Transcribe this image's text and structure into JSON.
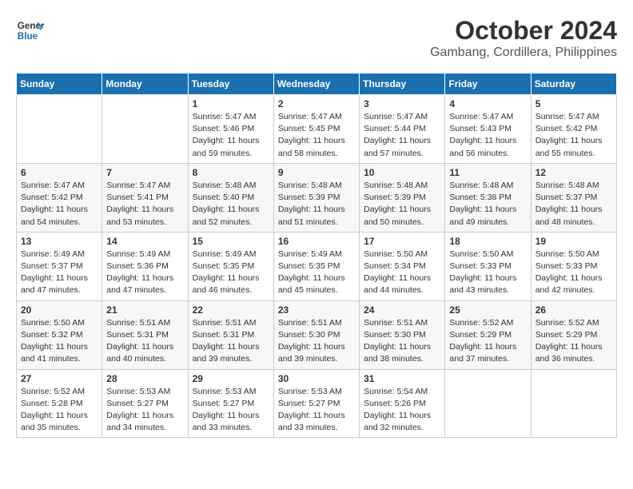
{
  "header": {
    "logo_line1": "General",
    "logo_line2": "Blue",
    "month": "October 2024",
    "location": "Gambang, Cordillera, Philippines"
  },
  "weekdays": [
    "Sunday",
    "Monday",
    "Tuesday",
    "Wednesday",
    "Thursday",
    "Friday",
    "Saturday"
  ],
  "weeks": [
    [
      {
        "day": "",
        "sunrise": "",
        "sunset": "",
        "daylight": ""
      },
      {
        "day": "",
        "sunrise": "",
        "sunset": "",
        "daylight": ""
      },
      {
        "day": "1",
        "sunrise": "Sunrise: 5:47 AM",
        "sunset": "Sunset: 5:46 PM",
        "daylight": "Daylight: 11 hours and 59 minutes."
      },
      {
        "day": "2",
        "sunrise": "Sunrise: 5:47 AM",
        "sunset": "Sunset: 5:45 PM",
        "daylight": "Daylight: 11 hours and 58 minutes."
      },
      {
        "day": "3",
        "sunrise": "Sunrise: 5:47 AM",
        "sunset": "Sunset: 5:44 PM",
        "daylight": "Daylight: 11 hours and 57 minutes."
      },
      {
        "day": "4",
        "sunrise": "Sunrise: 5:47 AM",
        "sunset": "Sunset: 5:43 PM",
        "daylight": "Daylight: 11 hours and 56 minutes."
      },
      {
        "day": "5",
        "sunrise": "Sunrise: 5:47 AM",
        "sunset": "Sunset: 5:42 PM",
        "daylight": "Daylight: 11 hours and 55 minutes."
      }
    ],
    [
      {
        "day": "6",
        "sunrise": "Sunrise: 5:47 AM",
        "sunset": "Sunset: 5:42 PM",
        "daylight": "Daylight: 11 hours and 54 minutes."
      },
      {
        "day": "7",
        "sunrise": "Sunrise: 5:47 AM",
        "sunset": "Sunset: 5:41 PM",
        "daylight": "Daylight: 11 hours and 53 minutes."
      },
      {
        "day": "8",
        "sunrise": "Sunrise: 5:48 AM",
        "sunset": "Sunset: 5:40 PM",
        "daylight": "Daylight: 11 hours and 52 minutes."
      },
      {
        "day": "9",
        "sunrise": "Sunrise: 5:48 AM",
        "sunset": "Sunset: 5:39 PM",
        "daylight": "Daylight: 11 hours and 51 minutes."
      },
      {
        "day": "10",
        "sunrise": "Sunrise: 5:48 AM",
        "sunset": "Sunset: 5:39 PM",
        "daylight": "Daylight: 11 hours and 50 minutes."
      },
      {
        "day": "11",
        "sunrise": "Sunrise: 5:48 AM",
        "sunset": "Sunset: 5:38 PM",
        "daylight": "Daylight: 11 hours and 49 minutes."
      },
      {
        "day": "12",
        "sunrise": "Sunrise: 5:48 AM",
        "sunset": "Sunset: 5:37 PM",
        "daylight": "Daylight: 11 hours and 48 minutes."
      }
    ],
    [
      {
        "day": "13",
        "sunrise": "Sunrise: 5:49 AM",
        "sunset": "Sunset: 5:37 PM",
        "daylight": "Daylight: 11 hours and 47 minutes."
      },
      {
        "day": "14",
        "sunrise": "Sunrise: 5:49 AM",
        "sunset": "Sunset: 5:36 PM",
        "daylight": "Daylight: 11 hours and 47 minutes."
      },
      {
        "day": "15",
        "sunrise": "Sunrise: 5:49 AM",
        "sunset": "Sunset: 5:35 PM",
        "daylight": "Daylight: 11 hours and 46 minutes."
      },
      {
        "day": "16",
        "sunrise": "Sunrise: 5:49 AM",
        "sunset": "Sunset: 5:35 PM",
        "daylight": "Daylight: 11 hours and 45 minutes."
      },
      {
        "day": "17",
        "sunrise": "Sunrise: 5:50 AM",
        "sunset": "Sunset: 5:34 PM",
        "daylight": "Daylight: 11 hours and 44 minutes."
      },
      {
        "day": "18",
        "sunrise": "Sunrise: 5:50 AM",
        "sunset": "Sunset: 5:33 PM",
        "daylight": "Daylight: 11 hours and 43 minutes."
      },
      {
        "day": "19",
        "sunrise": "Sunrise: 5:50 AM",
        "sunset": "Sunset: 5:33 PM",
        "daylight": "Daylight: 11 hours and 42 minutes."
      }
    ],
    [
      {
        "day": "20",
        "sunrise": "Sunrise: 5:50 AM",
        "sunset": "Sunset: 5:32 PM",
        "daylight": "Daylight: 11 hours and 41 minutes."
      },
      {
        "day": "21",
        "sunrise": "Sunrise: 5:51 AM",
        "sunset": "Sunset: 5:31 PM",
        "daylight": "Daylight: 11 hours and 40 minutes."
      },
      {
        "day": "22",
        "sunrise": "Sunrise: 5:51 AM",
        "sunset": "Sunset: 5:31 PM",
        "daylight": "Daylight: 11 hours and 39 minutes."
      },
      {
        "day": "23",
        "sunrise": "Sunrise: 5:51 AM",
        "sunset": "Sunset: 5:30 PM",
        "daylight": "Daylight: 11 hours and 39 minutes."
      },
      {
        "day": "24",
        "sunrise": "Sunrise: 5:51 AM",
        "sunset": "Sunset: 5:30 PM",
        "daylight": "Daylight: 11 hours and 38 minutes."
      },
      {
        "day": "25",
        "sunrise": "Sunrise: 5:52 AM",
        "sunset": "Sunset: 5:29 PM",
        "daylight": "Daylight: 11 hours and 37 minutes."
      },
      {
        "day": "26",
        "sunrise": "Sunrise: 5:52 AM",
        "sunset": "Sunset: 5:29 PM",
        "daylight": "Daylight: 11 hours and 36 minutes."
      }
    ],
    [
      {
        "day": "27",
        "sunrise": "Sunrise: 5:52 AM",
        "sunset": "Sunset: 5:28 PM",
        "daylight": "Daylight: 11 hours and 35 minutes."
      },
      {
        "day": "28",
        "sunrise": "Sunrise: 5:53 AM",
        "sunset": "Sunset: 5:27 PM",
        "daylight": "Daylight: 11 hours and 34 minutes."
      },
      {
        "day": "29",
        "sunrise": "Sunrise: 5:53 AM",
        "sunset": "Sunset: 5:27 PM",
        "daylight": "Daylight: 11 hours and 33 minutes."
      },
      {
        "day": "30",
        "sunrise": "Sunrise: 5:53 AM",
        "sunset": "Sunset: 5:27 PM",
        "daylight": "Daylight: 11 hours and 33 minutes."
      },
      {
        "day": "31",
        "sunrise": "Sunrise: 5:54 AM",
        "sunset": "Sunset: 5:26 PM",
        "daylight": "Daylight: 11 hours and 32 minutes."
      },
      {
        "day": "",
        "sunrise": "",
        "sunset": "",
        "daylight": ""
      },
      {
        "day": "",
        "sunrise": "",
        "sunset": "",
        "daylight": ""
      }
    ]
  ]
}
